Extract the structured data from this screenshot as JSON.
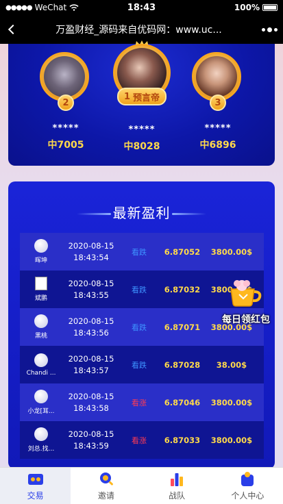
{
  "status_bar": {
    "carrier": "WeChat",
    "time": "18:43",
    "battery": "100%"
  },
  "nav": {
    "title": "万盈财经_源码来自优码网：www.uc..."
  },
  "ranking": [
    {
      "place": "2",
      "mask": "*****",
      "score": "中7005"
    },
    {
      "place": "1",
      "title": "预言帝",
      "mask": "*****",
      "score": "中8028"
    },
    {
      "place": "3",
      "mask": "*****",
      "score": "中6896"
    }
  ],
  "profit": {
    "title": "最新盈利",
    "rows": [
      {
        "user": "晖坤",
        "date": "2020-08-15",
        "time": "18:43:54",
        "direction": "看跌",
        "dir": "down",
        "price": "6.87052",
        "amount": "3800.00$"
      },
      {
        "user": "斌鹏",
        "date": "2020-08-15",
        "time": "18:43:55",
        "direction": "看跌",
        "dir": "down",
        "price": "6.87032",
        "amount": "3800.00$",
        "broken_avatar": true
      },
      {
        "user": "黑桃",
        "date": "2020-08-15",
        "time": "18:43:56",
        "direction": "看跌",
        "dir": "down",
        "price": "6.87071",
        "amount": "3800.00$"
      },
      {
        "user": "Chandi ...",
        "date": "2020-08-15",
        "time": "18:43:57",
        "direction": "看跌",
        "dir": "down",
        "price": "6.87028",
        "amount": "38.00$"
      },
      {
        "user": "小龙[耳...",
        "date": "2020-08-15",
        "time": "18:43:58",
        "direction": "看涨",
        "dir": "up",
        "price": "6.87046",
        "amount": "3800.00$"
      },
      {
        "user": "刘总.找...",
        "date": "2020-08-15",
        "time": "18:43:59",
        "direction": "看涨",
        "dir": "up",
        "price": "6.87033",
        "amount": "3800.00$"
      }
    ]
  },
  "floating": {
    "label": "每日领红包",
    "icon": "gift-cup-icon"
  },
  "tabs": [
    {
      "label": "交易",
      "icon": "trade-icon",
      "active": true
    },
    {
      "label": "邀请",
      "icon": "invite-icon"
    },
    {
      "label": "战队",
      "icon": "team-icon"
    },
    {
      "label": "个人中心",
      "icon": "profile-icon"
    }
  ],
  "colors": {
    "accent": "#1a24d8",
    "gold": "#ffd94a",
    "down": "#3e92ff",
    "up": "#ff3b53"
  }
}
